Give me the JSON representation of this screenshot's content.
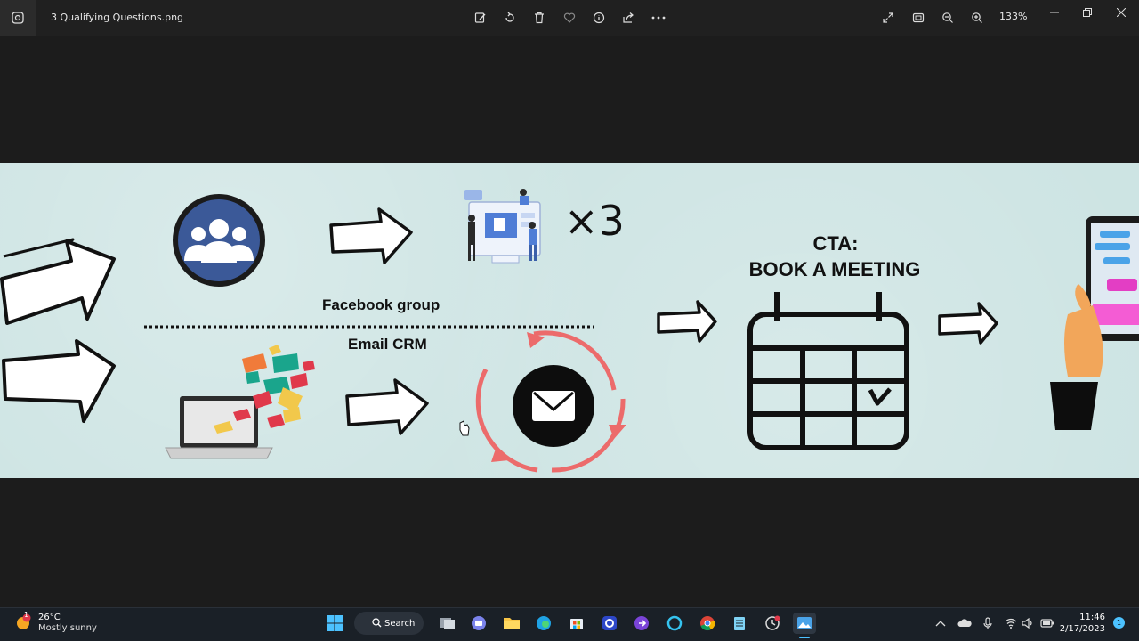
{
  "window": {
    "title": "3 Qualifying Questions.png",
    "zoom": "133%"
  },
  "toolbar": {
    "icons": [
      "edit-icon",
      "rotate-icon",
      "delete-icon",
      "favorite-icon",
      "info-icon",
      "share-icon",
      "more-icon"
    ],
    "right_icons": [
      "fullscreen-icon",
      "fit-icon",
      "zoom-out-icon",
      "zoom-in-icon"
    ]
  },
  "image": {
    "facebook_label": "Facebook group",
    "email_label": "Email CRM",
    "times": "×3",
    "cta_line1": "CTA:",
    "cta_line2": "BOOK A MEETING"
  },
  "taskbar": {
    "weather_temp": "26°C",
    "weather_desc": "Mostly sunny",
    "weather_badge": "1",
    "search_label": "Search",
    "time": "11:46",
    "date": "2/17/2023",
    "notifications": "1"
  },
  "colors": {
    "titlebar": "#202020",
    "image_bg": "#cde4e3",
    "facebook_blue": "#3b5998",
    "sync_red": "#ec6b6b",
    "taskbar": "#1a2027"
  }
}
